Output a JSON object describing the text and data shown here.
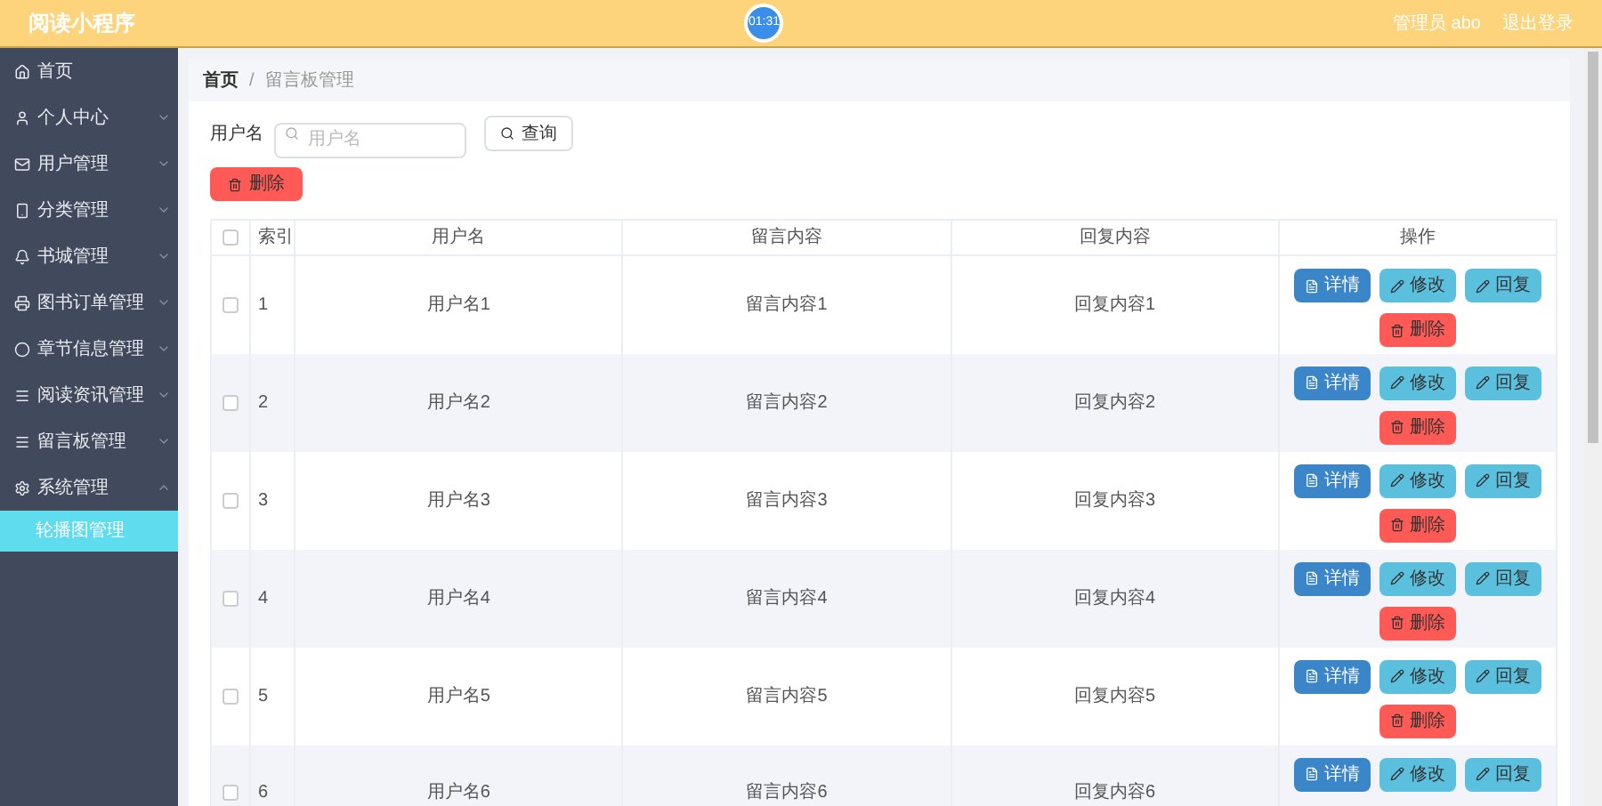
{
  "header": {
    "title": "阅读小程序",
    "clock": "01:31",
    "user": "管理员 abo",
    "logout": "退出登录"
  },
  "sidebar": {
    "items": [
      {
        "label": "首页",
        "expanded": false
      },
      {
        "label": "个人中心",
        "expanded": false
      },
      {
        "label": "用户管理",
        "expanded": false
      },
      {
        "label": "分类管理",
        "expanded": false
      },
      {
        "label": "书城管理",
        "expanded": false
      },
      {
        "label": "图书订单管理",
        "expanded": false
      },
      {
        "label": "章节信息管理",
        "expanded": false
      },
      {
        "label": "阅读资讯管理",
        "expanded": false
      },
      {
        "label": "留言板管理",
        "expanded": false
      },
      {
        "label": "系统管理",
        "expanded": true,
        "children": [
          {
            "label": "轮播图管理",
            "selected": true
          }
        ]
      }
    ]
  },
  "breadcrumb": {
    "separator": "/",
    "items": [
      {
        "label": "首页",
        "current": false
      },
      {
        "label": "留言板管理",
        "current": true
      }
    ]
  },
  "search": {
    "label": "用户名",
    "placeholder": "用户名",
    "button": "查询"
  },
  "delete_button": "删除",
  "table": {
    "header_checked": false,
    "columns": [
      "索引",
      "用户名",
      "留言内容",
      "回复内容",
      "操作"
    ],
    "rows": [
      {
        "index": "1",
        "user": "用户名1",
        "message": "留言内容1",
        "reply": "回复内容1",
        "checked": false,
        "actions": [
          {
            "kind": "detail",
            "label": "详情"
          },
          {
            "kind": "edit",
            "label": "修改"
          },
          {
            "kind": "reply",
            "label": "回复"
          },
          {
            "kind": "delete",
            "label": "删除"
          }
        ]
      },
      {
        "index": "2",
        "user": "用户名2",
        "message": "留言内容2",
        "reply": "回复内容2",
        "checked": false,
        "actions": [
          {
            "kind": "detail",
            "label": "详情"
          },
          {
            "kind": "edit",
            "label": "修改"
          },
          {
            "kind": "reply",
            "label": "回复"
          },
          {
            "kind": "delete",
            "label": "删除"
          }
        ]
      },
      {
        "index": "3",
        "user": "用户名3",
        "message": "留言内容3",
        "reply": "回复内容3",
        "checked": false,
        "actions": [
          {
            "kind": "detail",
            "label": "详情"
          },
          {
            "kind": "edit",
            "label": "修改"
          },
          {
            "kind": "reply",
            "label": "回复"
          },
          {
            "kind": "delete",
            "label": "删除"
          }
        ]
      },
      {
        "index": "4",
        "user": "用户名4",
        "message": "留言内容4",
        "reply": "回复内容4",
        "checked": false,
        "actions": [
          {
            "kind": "detail",
            "label": "详情"
          },
          {
            "kind": "edit",
            "label": "修改"
          },
          {
            "kind": "reply",
            "label": "回复"
          },
          {
            "kind": "delete",
            "label": "删除"
          }
        ]
      },
      {
        "index": "5",
        "user": "用户名5",
        "message": "留言内容5",
        "reply": "回复内容5",
        "checked": false,
        "actions": [
          {
            "kind": "detail",
            "label": "详情"
          },
          {
            "kind": "edit",
            "label": "修改"
          },
          {
            "kind": "reply",
            "label": "回复"
          },
          {
            "kind": "delete",
            "label": "删除"
          }
        ]
      },
      {
        "index": "6",
        "user": "用户名6",
        "message": "留言内容6",
        "reply": "回复内容6",
        "checked": false,
        "actions": [
          {
            "kind": "detail",
            "label": "详情"
          },
          {
            "kind": "edit",
            "label": "修改"
          },
          {
            "kind": "reply",
            "label": "回复"
          }
        ]
      }
    ]
  }
}
